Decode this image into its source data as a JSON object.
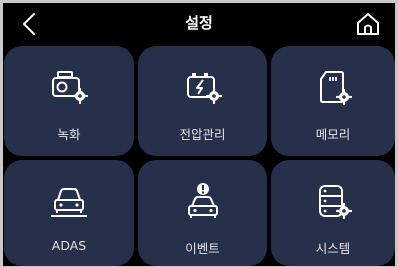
{
  "header": {
    "title": "설정",
    "back_icon": "chevron-left-icon",
    "home_icon": "home-icon"
  },
  "tiles": [
    {
      "label": "녹화",
      "icon": "dashcam-settings-icon"
    },
    {
      "label": "전압관리",
      "icon": "battery-settings-icon"
    },
    {
      "label": "메모리",
      "icon": "sd-card-settings-icon"
    },
    {
      "label": "ADAS",
      "icon": "car-lane-icon"
    },
    {
      "label": "이벤트",
      "icon": "car-alert-icon"
    },
    {
      "label": "시스템",
      "icon": "server-settings-icon"
    }
  ],
  "colors": {
    "background": "#000000",
    "tile": "#27304a",
    "text": "#e6e6e6",
    "icon": "#ffffff"
  }
}
